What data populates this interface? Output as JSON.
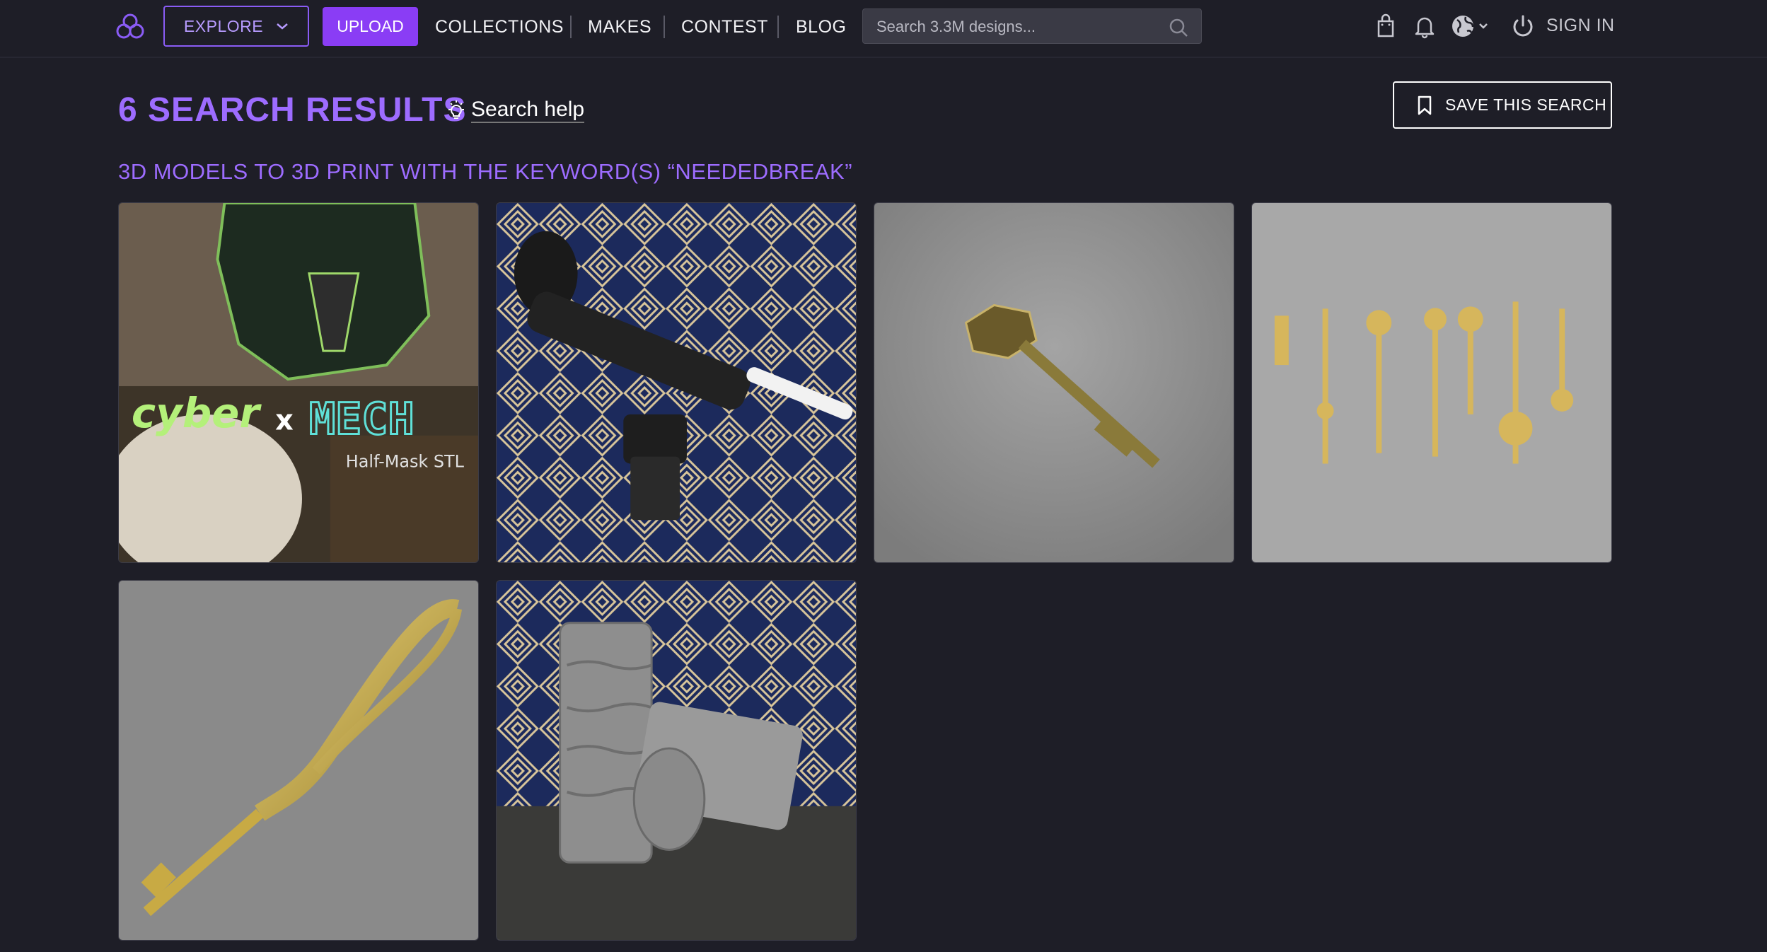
{
  "nav": {
    "explore_label": "EXPLORE",
    "upload_label": "UPLOAD",
    "links": [
      "COLLECTIONS",
      "MAKES",
      "CONTEST",
      "BLOG"
    ],
    "search_placeholder": "Search 3.3M designs...",
    "signin_label": "SIGN IN",
    "icons": [
      "bag-icon",
      "bell-icon",
      "globe-icon",
      "power-icon"
    ]
  },
  "header": {
    "results_title": "6 SEARCH RESULTS",
    "help_label": "Search help",
    "save_label": "SAVE THIS SEARCH",
    "subtitle": "3D MODELS TO 3D PRINT WITH THE KEYWORD(S) “NEEDEDBREAK”"
  },
  "results": [
    {
      "overlay_word_1": "cyber",
      "overlay_x": "x",
      "overlay_word_2": "MECH",
      "overlay_caption": "Half-Mask STL"
    },
    {},
    {},
    {},
    {},
    {}
  ],
  "colors": {
    "background": "#1e1e27",
    "accent_purple": "#8a3df5",
    "title_purple": "#9d6cff"
  }
}
